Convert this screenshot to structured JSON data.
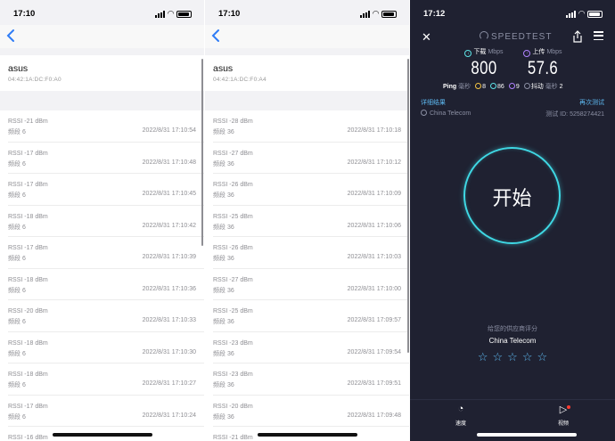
{
  "left_screen": {
    "status_time": "17:10",
    "device": {
      "name": "asus",
      "mac": "04:42:1A:DC:F0:A0"
    },
    "rows": [
      {
        "rssi": "RSSI -21 dBm",
        "band": "频段 6",
        "time": "2022/8/31 17:10:54"
      },
      {
        "rssi": "RSSI -17 dBm",
        "band": "频段 6",
        "time": "2022/8/31 17:10:48"
      },
      {
        "rssi": "RSSI -17 dBm",
        "band": "频段 6",
        "time": "2022/8/31 17:10:45"
      },
      {
        "rssi": "RSSI -18 dBm",
        "band": "频段 6",
        "time": "2022/8/31 17:10:42"
      },
      {
        "rssi": "RSSI -17 dBm",
        "band": "频段 6",
        "time": "2022/8/31 17:10:39"
      },
      {
        "rssi": "RSSI -18 dBm",
        "band": "频段 6",
        "time": "2022/8/31 17:10:36"
      },
      {
        "rssi": "RSSI -20 dBm",
        "band": "频段 6",
        "time": "2022/8/31 17:10:33"
      },
      {
        "rssi": "RSSI -18 dBm",
        "band": "频段 6",
        "time": "2022/8/31 17:10:30"
      },
      {
        "rssi": "RSSI -18 dBm",
        "band": "频段 6",
        "time": "2022/8/31 17:10:27"
      },
      {
        "rssi": "RSSI -17 dBm",
        "band": "频段 6",
        "time": "2022/8/31 17:10:24"
      },
      {
        "rssi": "RSSI -16 dBm",
        "band": "",
        "time": ""
      }
    ]
  },
  "middle_screen": {
    "status_time": "17:10",
    "device": {
      "name": "asus",
      "mac": "04:42:1A:DC:F0:A4"
    },
    "rows": [
      {
        "rssi": "RSSI -28 dBm",
        "band": "频段 36",
        "time": "2022/8/31 17:10:18"
      },
      {
        "rssi": "RSSI -27 dBm",
        "band": "频段 36",
        "time": "2022/8/31 17:10:12"
      },
      {
        "rssi": "RSSI -26 dBm",
        "band": "频段 36",
        "time": "2022/8/31 17:10:09"
      },
      {
        "rssi": "RSSI -25 dBm",
        "band": "频段 36",
        "time": "2022/8/31 17:10:06"
      },
      {
        "rssi": "RSSI -26 dBm",
        "band": "频段 36",
        "time": "2022/8/31 17:10:03"
      },
      {
        "rssi": "RSSI -27 dBm",
        "band": "频段 36",
        "time": "2022/8/31 17:10:00"
      },
      {
        "rssi": "RSSI -25 dBm",
        "band": "频段 36",
        "time": "2022/8/31 17:09:57"
      },
      {
        "rssi": "RSSI -23 dBm",
        "band": "频段 36",
        "time": "2022/8/31 17:09:54"
      },
      {
        "rssi": "RSSI -23 dBm",
        "band": "频段 36",
        "time": "2022/8/31 17:09:51"
      },
      {
        "rssi": "RSSI -20 dBm",
        "band": "频段 36",
        "time": "2022/8/31 17:09:48"
      },
      {
        "rssi": "RSSI -21 dBm",
        "band": "",
        "time": ""
      }
    ]
  },
  "speedtest": {
    "status_time": "17:12",
    "brand": "SPEEDTEST",
    "download": {
      "label": "下载",
      "unit": "Mbps",
      "value": "800"
    },
    "upload": {
      "label": "上传",
      "unit": "Mbps",
      "value": "57.6"
    },
    "ping": {
      "label": "Ping",
      "unit": "毫秒",
      "idle": "8",
      "download": "86",
      "upload": "9",
      "jitter_label": "抖动",
      "jitter_unit": "毫秒",
      "jitter": "2"
    },
    "details_link": "详细结果",
    "retest_link": "再次测试",
    "isp": "China Telecom",
    "test_id": "测试 ID: 5258274421",
    "go_label": "开始",
    "rate_prompt": "给您的供应商评分",
    "rate_isp": "China Telecom",
    "stars": 5,
    "tabs": {
      "speed": "速度",
      "video": "视频"
    },
    "colors": {
      "background": "#1f2131",
      "accent": "#3fd8e4",
      "link": "#5db8f0",
      "upload": "#b083ff"
    }
  }
}
